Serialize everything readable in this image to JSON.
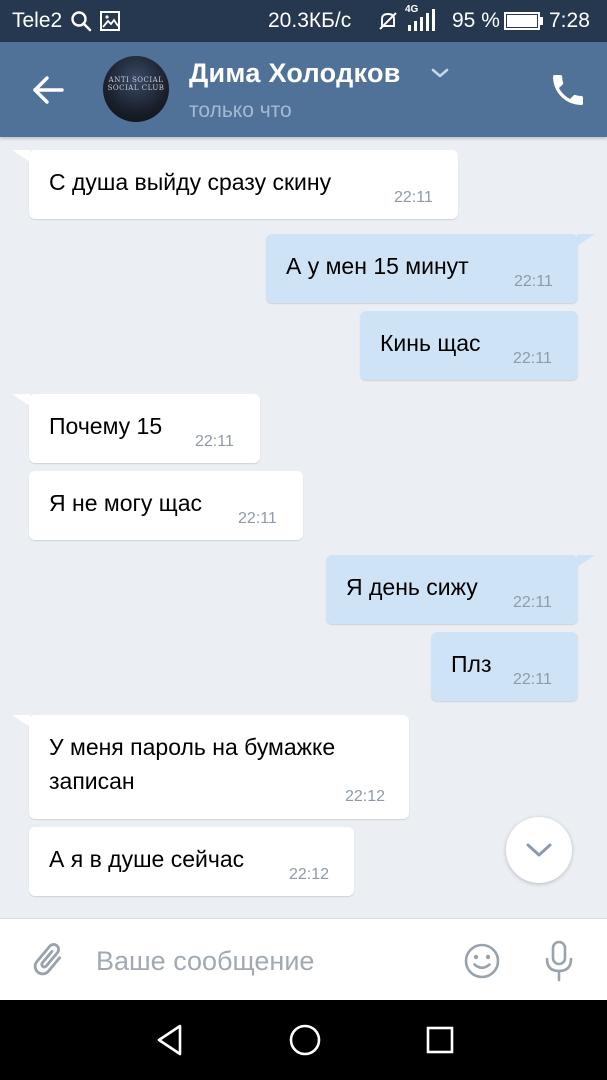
{
  "status_bar": {
    "carrier": "Tele2",
    "speed": "20.3КБ/с",
    "network": "4G",
    "battery": "95 %",
    "time": "7:28",
    "icons": [
      "search-icon",
      "image-icon",
      "mute-icon",
      "signal-icon",
      "battery-icon"
    ]
  },
  "header": {
    "contact_name": "Дима Холодков",
    "status": "только что",
    "avatar_text": "ANTI SOCIAL SOCIAL CLUB",
    "icons": [
      "back-arrow-icon",
      "chevron-down-icon",
      "phone-icon"
    ]
  },
  "messages": [
    {
      "direction": "in",
      "text": "С душа выйду сразу скину",
      "time": "22:11"
    },
    {
      "direction": "out",
      "text": "А у мен 15 минут",
      "time": "22:11"
    },
    {
      "direction": "out",
      "text": "Кинь щас",
      "time": "22:11"
    },
    {
      "direction": "in",
      "text": "Почему 15",
      "time": "22:11"
    },
    {
      "direction": "in",
      "text": "Я не могу щас",
      "time": "22:11"
    },
    {
      "direction": "out",
      "text": "Я день сижу",
      "time": "22:11"
    },
    {
      "direction": "out",
      "text": "Плз",
      "time": "22:11"
    },
    {
      "direction": "in",
      "text_line1": "У меня пароль на бумажке",
      "text_line2": "записан",
      "time": "22:12"
    },
    {
      "direction": "in",
      "text": "А я в душе сейчас",
      "time": "22:12"
    }
  ],
  "composer": {
    "placeholder": "Ваше сообщение",
    "icons": [
      "paperclip-icon",
      "smile-icon",
      "microphone-icon"
    ]
  },
  "nav_bar": {
    "icons": [
      "back-triangle-icon",
      "home-circle-icon",
      "recents-square-icon"
    ]
  },
  "colors": {
    "status_bar": "#25384f",
    "header": "#507299",
    "chat_background": "#ebeff3",
    "incoming_bubble": "#ffffff",
    "outgoing_bubble": "#cfe3f6",
    "time_text": "#8e9aa7"
  }
}
